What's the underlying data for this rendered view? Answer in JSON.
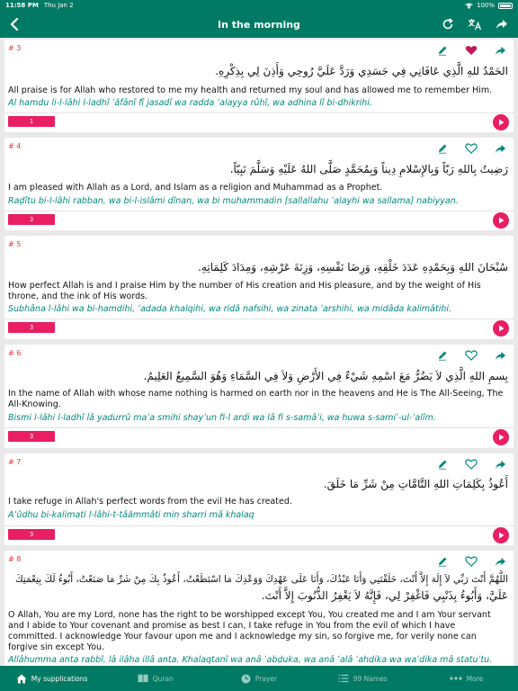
{
  "status": {
    "time": "11:58 PM",
    "date": "Thu Jan 2",
    "battery": "100%"
  },
  "header": {
    "title": "In the morning"
  },
  "cards": [
    {
      "number": "# 3",
      "arabic": "الحَمْدُ للهِ الَّذِي عَافَانِي فِي جَسَدِي وَرَدَّ عَلَيَّ رُوحِي وَأَذِنَ لِي بِذِكْرِهِ.",
      "translation": "All praise is for Allah who restored to me my health and returned my soul and has allowed me to remember Him.",
      "transliteration": "Al hamdu li-l-lâhi l-ladhî ʿâfânî fî jasadî wa radda ʿalayya rûhî, wa adhina lî bi-dhikrihi.",
      "count": "1",
      "favorite": true
    },
    {
      "number": "# 4",
      "arabic": "رَضِيتُ بِاللهِ رَبّاً وَبِالإِسْلامِ دِيناً وَبِمُحَمَّدٍ صَلَّى اللهُ عَلَيْهِ وَسَلَّمَ نَبِيّاً.",
      "translation": "I am pleased with Allah as a Lord, and Islam as a religion and Muhammad as a Prophet.",
      "transliteration": "Raḍîtu bi-l-lâhi rabban, wa bi-l-islâmi dînan, wa bi muhammadin [sallallahu ʿalayhi wa sallama] nabiyyan.",
      "count": "3",
      "favorite": false
    },
    {
      "number": "# 5",
      "arabic": "سُبْحَانَ اللهِ وَبِحَمْدِهِ عَدَدَ خَلْقِهِ، وَرِضَا نَفْسِهِ، وَزِنَةَ عَرْشِهِ، وَمِدَادَ كَلِمَاتِهِ.",
      "translation": "How perfect Allah is and I praise Him by the number of His creation and His pleasure, and by the weight of His throne, and the ink of His words.",
      "transliteration": "Subhâna l-lâhi wa bi-hamdihi, ʿadada khalqihi, wa ridâ nafsihi, wa zinata ʿarshihi, wa midâda kalimâtihi.",
      "count": "3",
      "favorite": false
    },
    {
      "number": "# 6",
      "arabic": "بِسمِ اللهِ الَّذِي لاَ يَضُرُّ مَعَ اسْمِهِ شَيْءٌ فِي الأَرْضِ وَلاَ فِي السَّمَاءِ وَهُوَ السَّمِيعُ العَلِيمُ.",
      "translation": "In the name of Allah with whose name nothing is harmed on earth nor in the heavens and He is The All-Seeing, The All-Knowing.",
      "transliteration": "Bismi l-lâhi l-ladhî lâ yadurrû maʿa smihi shayʾun fi-l ardi wa lâ fi s-samâʾi, wa huwa s-samiʿ-ul-ʿalîm.",
      "count": "3",
      "favorite": false
    },
    {
      "number": "# 7",
      "arabic": "أَعُوذُ بِكَلِمَاتِ اللهِ التَّامَّاتِ مِنْ شَرِّ مَا خَلَقَ.",
      "translation": "I take refuge in Allah's perfect words from the evil He has created.",
      "transliteration": "Aʿûdhu bi-kalimati l-lâhi-t-tâămmâti min sharri mâ khalaq",
      "count": "3",
      "favorite": false
    },
    {
      "number": "# 8",
      "arabic_line1": "اللَّهُمَّ أَنْتَ رَبِّي لاَ إِلَهَ إِلاَّ أَنْتَ، خَلَقْتَنِي وَأَنَا عَبْدُكَ، وَأَنَا عَلَى عَهْدِكَ وَوَعْدِكَ مَا اسْتَطَعْتُ، أَعُوذُ بِكَ مِنْ شَرِّ مَا صَنَعْتُ، أَبُوءُ لَكَ بِنِعْمَتِكَ",
      "arabic_line2": "عَلَيَّ، وَأَبُوءُ بِذَنْبِي فَاغْفِرْ لِي، فَإِنَّهُ لاَ يَغْفِرُ الذُّنُوبَ إِلاَّ أَنْتَ.",
      "translation": "O Allah, You are my Lord, none has the right to be worshipped except You, You created me and I am Your servant and I abide to Your covenant and promise as best I can, I take refuge in You from the evil of which I have committed. I acknowledge Your favour upon me and I acknowledge my sin, so forgive me, for verily none can forgive sin except You.",
      "transliteration": "Allâhumma anta rabbî, lâ ilâha illâ anta. Khalaqtanî wa anâ ʿabduka, wa anâ ʿalâ ʿahdika wa waʿdika mâ statuʿtu. Aʿûdhu bika min sharri mâ sanaʿtu. Abûʾu laka bi-niʿmatika ʿalayya wa abûʾu bi-dhanbî. Fa-ghfir lî fa-innahu lâ yaghfiru dh-dhunûba illâ anta.",
      "favorite": false
    }
  ],
  "tabs": [
    {
      "label": "My supplications",
      "icon": "home-icon",
      "active": true
    },
    {
      "label": "Quran",
      "icon": "book-icon",
      "active": false
    },
    {
      "label": "Prayer",
      "icon": "clock-icon",
      "active": false
    },
    {
      "label": "99 Names",
      "icon": "list-icon",
      "active": false
    },
    {
      "label": "More",
      "icon": "more-icon",
      "active": false
    }
  ],
  "colors": {
    "primary": "#007a64",
    "accent": "#e91e63",
    "transliteration": "#00897b"
  }
}
